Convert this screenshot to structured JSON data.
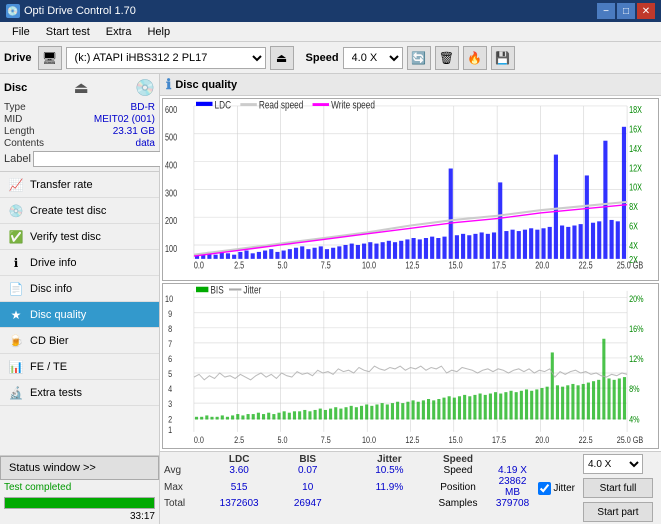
{
  "app": {
    "title": "Opti Drive Control 1.70",
    "icon": "💿"
  },
  "titlebar": {
    "title": "Opti Drive Control 1.70",
    "minimize_label": "−",
    "maximize_label": "□",
    "close_label": "✕"
  },
  "menubar": {
    "items": [
      "File",
      "Start test",
      "Extra",
      "Help"
    ]
  },
  "toolbar": {
    "drive_label": "Drive",
    "drive_value": "(k:) ATAPI iHBS312  2 PL17",
    "speed_label": "Speed",
    "speed_value": "4.0 X"
  },
  "disc": {
    "title": "Disc",
    "type_label": "Type",
    "type_value": "BD-R",
    "mid_label": "MID",
    "mid_value": "MEIT02 (001)",
    "length_label": "Length",
    "length_value": "23.31 GB",
    "contents_label": "Contents",
    "contents_value": "data",
    "label_label": "Label",
    "label_placeholder": ""
  },
  "nav": {
    "items": [
      {
        "id": "transfer-rate",
        "label": "Transfer rate",
        "icon": "📈"
      },
      {
        "id": "create-test-disc",
        "label": "Create test disc",
        "icon": "💿"
      },
      {
        "id": "verify-test-disc",
        "label": "Verify test disc",
        "icon": "✅"
      },
      {
        "id": "drive-info",
        "label": "Drive info",
        "icon": "ℹ"
      },
      {
        "id": "disc-info",
        "label": "Disc info",
        "icon": "📄"
      },
      {
        "id": "disc-quality",
        "label": "Disc quality",
        "icon": "★",
        "active": true
      },
      {
        "id": "cd-bier",
        "label": "CD Bier",
        "icon": "🍺"
      },
      {
        "id": "fe-te",
        "label": "FE / TE",
        "icon": "📊"
      },
      {
        "id": "extra-tests",
        "label": "Extra tests",
        "icon": "🔬"
      }
    ]
  },
  "status": {
    "window_btn": "Status window >>",
    "text": "Test completed",
    "progress": 100,
    "time": "33:17"
  },
  "disc_quality": {
    "title": "Disc quality",
    "chart1": {
      "legend": [
        {
          "id": "ldc",
          "label": "LDC",
          "color": "#0000ff"
        },
        {
          "id": "read-speed",
          "label": "Read speed",
          "color": "#ffffff"
        },
        {
          "id": "write-speed",
          "label": "Write speed",
          "color": "#ff00ff"
        }
      ],
      "y_left": [
        "600",
        "500",
        "400",
        "300",
        "200",
        "100",
        "0"
      ],
      "y_right": [
        "18X",
        "16X",
        "14X",
        "12X",
        "10X",
        "8X",
        "6X",
        "4X",
        "2X"
      ],
      "x_labels": [
        "0.0",
        "2.5",
        "5.0",
        "7.5",
        "10.0",
        "12.5",
        "15.0",
        "17.5",
        "20.0",
        "22.5",
        "25.0 GB"
      ]
    },
    "chart2": {
      "legend": [
        {
          "id": "bis",
          "label": "BIS",
          "color": "#00aa00"
        },
        {
          "id": "jitter-legend",
          "label": "Jitter",
          "color": "#888888"
        }
      ],
      "y_left": [
        "10",
        "9",
        "8",
        "7",
        "6",
        "5",
        "4",
        "3",
        "2",
        "1"
      ],
      "y_right": [
        "20%",
        "16%",
        "12%",
        "8%",
        "4%"
      ],
      "x_labels": [
        "0.0",
        "2.5",
        "5.0",
        "7.5",
        "10.0",
        "12.5",
        "15.0",
        "17.5",
        "20.0",
        "22.5",
        "25.0 GB"
      ]
    }
  },
  "stats": {
    "columns": [
      "",
      "LDC",
      "BIS",
      "",
      "Jitter",
      "Speed",
      ""
    ],
    "avg_label": "Avg",
    "avg_ldc": "3.60",
    "avg_bis": "0.07",
    "avg_jitter": "10.5%",
    "max_label": "Max",
    "max_ldc": "515",
    "max_bis": "10",
    "max_jitter": "11.9%",
    "total_label": "Total",
    "total_ldc": "1372603",
    "total_bis": "26947",
    "speed_label": "Speed",
    "speed_value": "4.19 X",
    "speed_select": "4.0 X",
    "position_label": "Position",
    "position_value": "23862 MB",
    "samples_label": "Samples",
    "samples_value": "379708",
    "jitter_checked": true,
    "jitter_label": "Jitter",
    "start_full_label": "Start full",
    "start_part_label": "Start part"
  }
}
